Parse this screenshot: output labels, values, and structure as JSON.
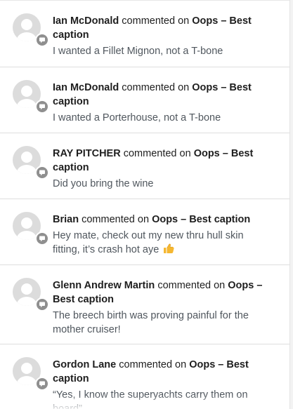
{
  "connector_text": "commented on",
  "notifications": [
    {
      "author": "Ian McDonald",
      "post_title": "Oops – Best caption",
      "excerpt": "I wanted a Fillet Mignon, not a T-bone"
    },
    {
      "author": "Ian McDonald",
      "post_title": "Oops – Best caption",
      "excerpt": "I wanted a Porterhouse, not a T-bone"
    },
    {
      "author": "RAY PITCHER",
      "post_title": "Oops – Best caption",
      "excerpt": "Did you bring the wine"
    },
    {
      "author": "Brian",
      "post_title": "Oops – Best caption",
      "excerpt": "Hey mate, check out my new thru hull skin fitting, it’s crash hot aye",
      "emoji": "thumbs-up-icon"
    },
    {
      "author": "Glenn Andrew Martin",
      "post_title": "Oops – Best caption",
      "excerpt": "The breech birth was proving painful for the mother cruiser!"
    },
    {
      "author": "Gordon Lane",
      "post_title": "Oops – Best caption",
      "excerpt": "“Yes, I know the superyachts carry them on board”..."
    }
  ],
  "colors": {
    "name_text": "#1e1e1e",
    "excerpt_text": "#50575e",
    "avatar_bg": "#dcdcdc",
    "badge_bg": "#8f8f8f",
    "divider": "#dedede",
    "emoji": "#f5b731"
  }
}
